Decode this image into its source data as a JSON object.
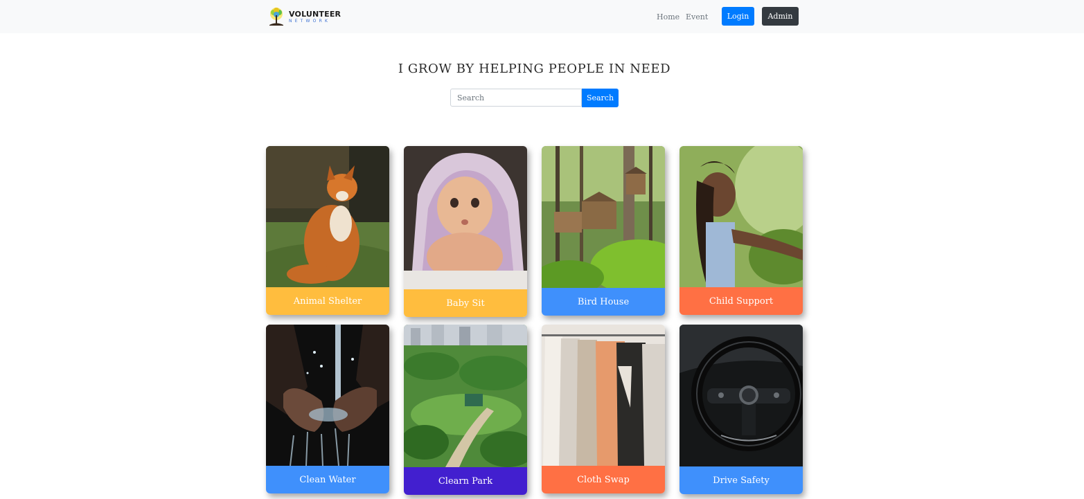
{
  "brand": {
    "name": "VOLUNTEER",
    "tagline": "NETWORK"
  },
  "nav": {
    "home": "Home",
    "event": "Event",
    "login": "Login",
    "admin": "Admin"
  },
  "hero": {
    "headline": "I GROW BY HELPING PEOPLE IN NEED"
  },
  "search": {
    "placeholder": "Search",
    "button": "Search"
  },
  "colors": {
    "yellow": "#ffbd3e",
    "blue": "#3f90fc",
    "orange": "#ff7044",
    "purple": "#421fcf",
    "primary": "#007bff",
    "dark": "#343a40"
  },
  "cards": [
    {
      "title": "Animal Shelter",
      "color": "#ffbd3e",
      "image": "fox-photo"
    },
    {
      "title": "Baby Sit",
      "color": "#ffbd3e",
      "image": "baby-photo"
    },
    {
      "title": "Bird House",
      "color": "#3f90fc",
      "image": "birdhouse-photo"
    },
    {
      "title": "Child Support",
      "color": "#ff7044",
      "image": "girl-photo"
    },
    {
      "title": "Clean Water",
      "color": "#3f90fc",
      "image": "water-hands-photo"
    },
    {
      "title": "Clearn Park",
      "color": "#421fcf",
      "image": "park-photo"
    },
    {
      "title": "Cloth Swap",
      "color": "#ff7044",
      "image": "clothes-rack-photo"
    },
    {
      "title": "Drive Safety",
      "color": "#3f90fc",
      "image": "steering-wheel-photo"
    }
  ]
}
